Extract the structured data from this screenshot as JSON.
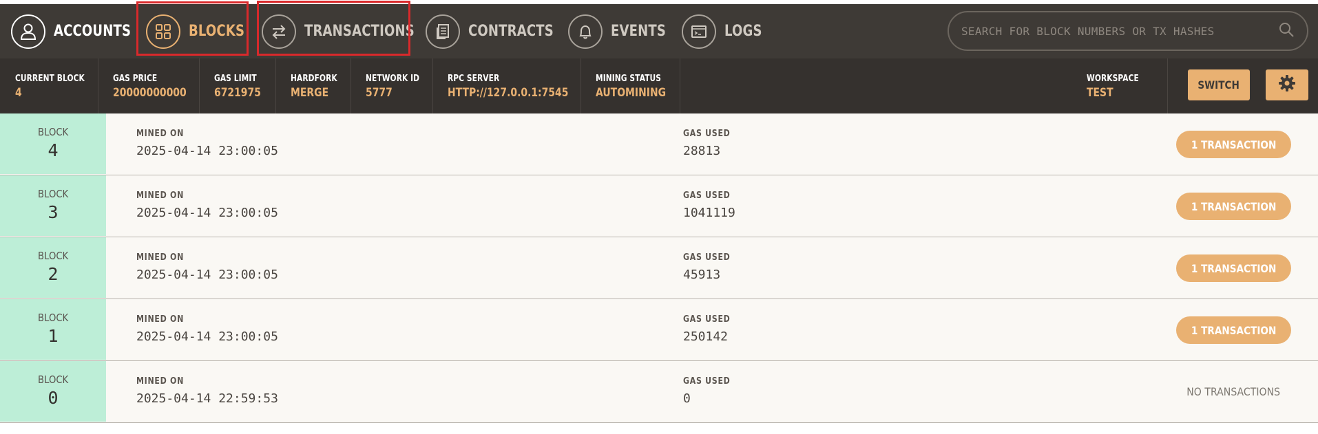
{
  "nav": {
    "items": [
      {
        "label": "ACCOUNTS",
        "icon": "user-icon"
      },
      {
        "label": "BLOCKS",
        "icon": "grid-icon"
      },
      {
        "label": "TRANSACTIONS",
        "icon": "transfer-arrows-icon"
      },
      {
        "label": "CONTRACTS",
        "icon": "document-icon"
      },
      {
        "label": "EVENTS",
        "icon": "bell-icon"
      },
      {
        "label": "LOGS",
        "icon": "terminal-icon"
      }
    ],
    "active": "BLOCKS",
    "search_placeholder": "SEARCH FOR BLOCK NUMBERS OR TX HASHES"
  },
  "status": {
    "current_block": {
      "label": "CURRENT BLOCK",
      "value": "4"
    },
    "gas_price": {
      "label": "GAS PRICE",
      "value": "20000000000"
    },
    "gas_limit": {
      "label": "GAS LIMIT",
      "value": "6721975"
    },
    "hardfork": {
      "label": "HARDFORK",
      "value": "MERGE"
    },
    "network_id": {
      "label": "NETWORK ID",
      "value": "5777"
    },
    "rpc_server": {
      "label": "RPC SERVER",
      "value": "HTTP://127.0.0.1:7545"
    },
    "mining_status": {
      "label": "MINING STATUS",
      "value": "AUTOMINING"
    },
    "workspace": {
      "label": "WORKSPACE",
      "value": "TEST"
    },
    "switch_label": "SWITCH"
  },
  "blocks": {
    "block_label": "BLOCK",
    "mined_on_label": "MINED ON",
    "gas_used_label": "GAS USED",
    "rows": [
      {
        "number": "4",
        "mined_on": "2025-04-14 23:00:05",
        "gas_used": "28813",
        "transactions": "1 TRANSACTION"
      },
      {
        "number": "3",
        "mined_on": "2025-04-14 23:00:05",
        "gas_used": "1041119",
        "transactions": "1 TRANSACTION"
      },
      {
        "number": "2",
        "mined_on": "2025-04-14 23:00:05",
        "gas_used": "45913",
        "transactions": "1 TRANSACTION"
      },
      {
        "number": "1",
        "mined_on": "2025-04-14 23:00:05",
        "gas_used": "250142",
        "transactions": "1 TRANSACTION"
      },
      {
        "number": "0",
        "mined_on": "2025-04-14 22:59:53",
        "gas_used": "0",
        "transactions": "NO TRANSACTIONS"
      }
    ]
  },
  "colors": {
    "nav_bg": "#3e3a36",
    "status_bg": "#35312e",
    "accent": "#e9b172",
    "block_cell": "#bdeed7",
    "highlight_box": "#d9292b"
  }
}
